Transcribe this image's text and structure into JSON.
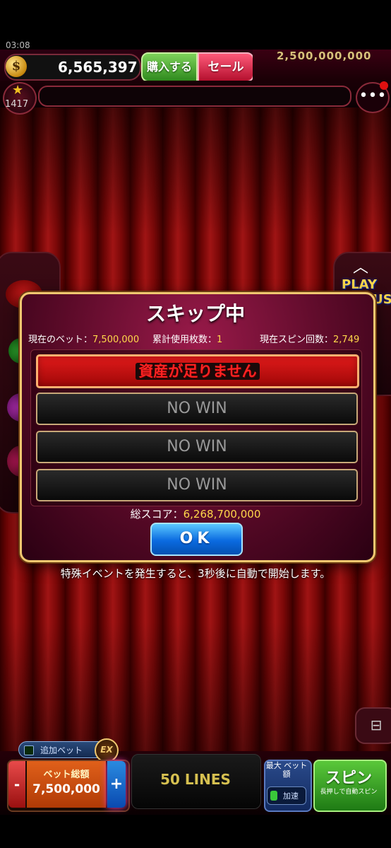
{
  "status_bar": {
    "time": "03:08"
  },
  "header": {
    "coin_balance": "6,565,397",
    "coin_icon_glyph": "$",
    "buy_label": "購入する",
    "sale_label": "セール",
    "jackpot_value": "2,500,000,000",
    "level": "1417",
    "menu_glyph": "•••"
  },
  "side": {
    "play_bonus_label": "PLAY BONUS"
  },
  "dialog": {
    "title": "スキップ中",
    "current_bet_label": "現在のベット：",
    "current_bet_value": "7,500,000",
    "used_count_label": "累計使用枚数：",
    "used_count_value": "1",
    "spin_count_label": "現在スピン回数：",
    "spin_count_value": "2,749",
    "rows": [
      {
        "text": "資産が足りません",
        "state": "error"
      },
      {
        "text": "NO WIN",
        "state": "normal"
      },
      {
        "text": "NO WIN",
        "state": "normal"
      },
      {
        "text": "NO WIN",
        "state": "normal"
      }
    ],
    "total_label": "総スコア：",
    "total_value": "6,268,700,000",
    "ok_label": "OK"
  },
  "notice": "特殊イベントを発生すると、3秒後に自動で開始します。",
  "bottom": {
    "extra_bet_label": "追加ベット",
    "ex_badge": "EX",
    "total_bet_label": "ベット総額",
    "total_bet_value": "7,500,000",
    "minus_label": "-",
    "plus_label": "+",
    "lines_label": "50 LINES",
    "max_bet_label": "最大 ベット額",
    "speed_label": "加速",
    "spin_label": "スピン",
    "spin_sub_label": "長押しで自動スピン"
  },
  "colors": {
    "accent_gold": "#ffd84a",
    "error_red": "#e01a1a",
    "ok_blue": "#0a6ae0",
    "spin_green": "#2f8a1e"
  }
}
